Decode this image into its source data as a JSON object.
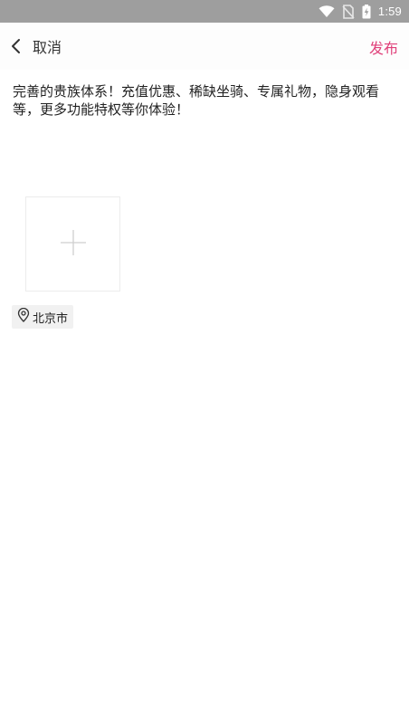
{
  "status_bar": {
    "time": "1:59",
    "icons": [
      "wifi-icon",
      "no-sim-icon",
      "battery-charging-icon"
    ]
  },
  "header": {
    "cancel_label": "取消",
    "publish_label": "发布"
  },
  "post": {
    "text": "完善的贵族体系！充值优惠、稀缺坐骑、专属礼物，隐身观看等，更多功能特权等你体验！"
  },
  "location": {
    "label": "北京市"
  },
  "colors": {
    "accent": "#e0407a",
    "status_bar": "#9e9e9e"
  }
}
